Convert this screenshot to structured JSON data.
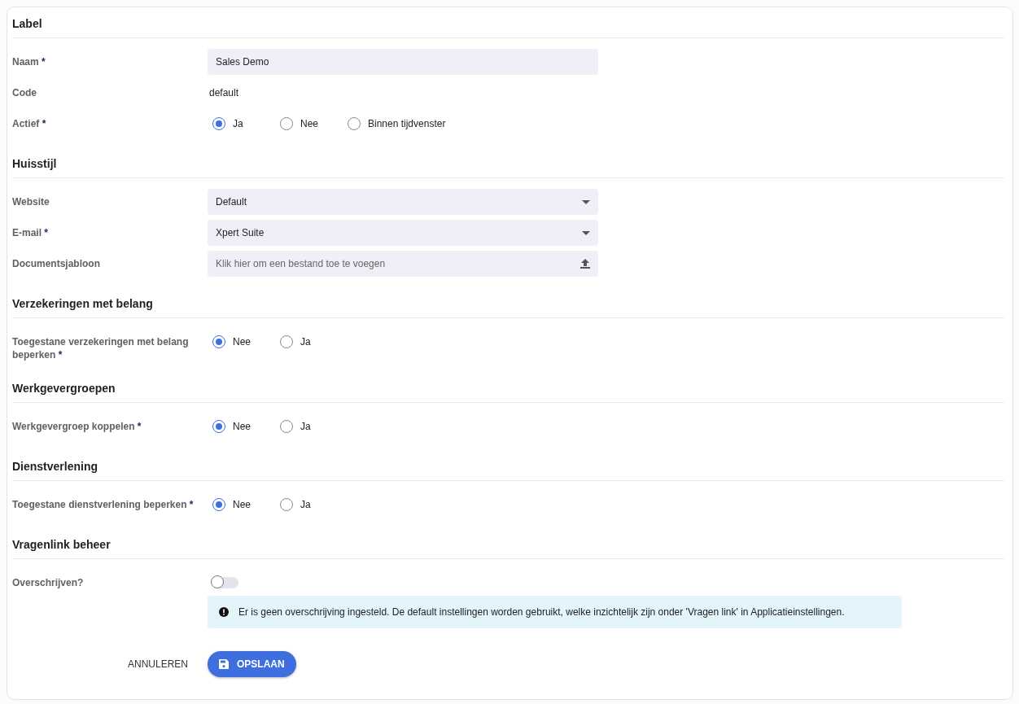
{
  "sections": [
    {
      "title": "Label",
      "fields": [
        {
          "kind": "input",
          "label": "Naam",
          "mark": "*",
          "value": "Sales Demo"
        },
        {
          "kind": "text",
          "label": "Code",
          "value": "default"
        },
        {
          "kind": "radio",
          "label": "Actief",
          "mark": "*",
          "options": [
            {
              "label": "Ja",
              "selected": true
            },
            {
              "label": "Nee",
              "selected": false
            },
            {
              "label": "Binnen tijdvenster",
              "selected": false
            }
          ]
        }
      ]
    },
    {
      "title": "Huisstijl",
      "fields": [
        {
          "kind": "select",
          "label": "Website",
          "value": "Default"
        },
        {
          "kind": "select",
          "label": "E-mail",
          "mark": "*",
          "value": "Xpert Suite"
        },
        {
          "kind": "upload",
          "label": "Documentsjabloon",
          "placeholder": "Klik hier om een bestand toe te voegen"
        }
      ]
    },
    {
      "title": "Verzekeringen met belang",
      "fields": [
        {
          "kind": "radio",
          "label": "Toegestane verzekeringen met belang beperken",
          "mark": "*",
          "options": [
            {
              "label": "Nee",
              "selected": true
            },
            {
              "label": "Ja",
              "selected": false
            }
          ]
        }
      ]
    },
    {
      "title": "Werkgevergroepen",
      "fields": [
        {
          "kind": "radio",
          "label": "Werkgevergroep koppelen",
          "mark": "*",
          "options": [
            {
              "label": "Nee",
              "selected": true
            },
            {
              "label": "Ja",
              "selected": false
            }
          ]
        }
      ]
    },
    {
      "title": "Dienstverlening",
      "fields": [
        {
          "kind": "radio",
          "label": "Toegestane dienstverlening beperken",
          "mark": "*",
          "options": [
            {
              "label": "Nee",
              "selected": true
            },
            {
              "label": "Ja",
              "selected": false
            }
          ]
        }
      ]
    },
    {
      "title": "Vragenlink beheer",
      "fields": [
        {
          "kind": "toggle",
          "label": "Overschrijven?",
          "on": false,
          "info": "Er is geen overschrijving ingesteld. De default instellingen worden gebruikt, welke inzichtelijk zijn onder 'Vragen link' in Applicatieinstellingen."
        }
      ]
    }
  ],
  "actions": {
    "cancel": "ANNULEREN",
    "save": "OPSLAAN"
  }
}
